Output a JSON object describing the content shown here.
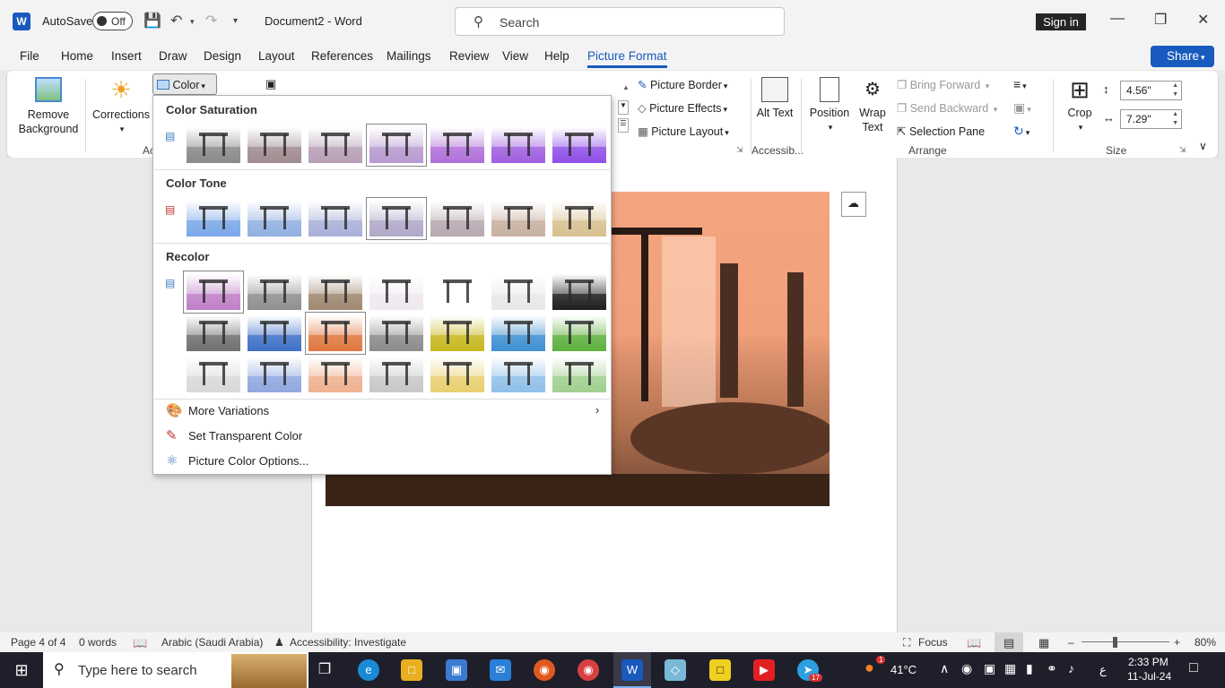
{
  "titlebar": {
    "autosave": "AutoSave",
    "toggle": "Off",
    "doc_title": "Document2  -  Word",
    "search_placeholder": "Search",
    "signin": "Sign in"
  },
  "tabs": [
    "File",
    "Home",
    "Insert",
    "Draw",
    "Design",
    "Layout",
    "References",
    "Mailings",
    "Review",
    "View",
    "Help",
    "Picture Format"
  ],
  "share": "Share",
  "ribbon": {
    "remove_bg": "Remove Background",
    "corrections": "Corrections",
    "color": "Color",
    "adjust_group": "Ac",
    "picture_border": "Picture Border",
    "picture_effects": "Picture Effects",
    "picture_layout": "Picture Layout",
    "alt_text": "Alt Text",
    "accessibility_group": "Accessib...",
    "position": "Position",
    "wrap_text": "Wrap Text",
    "bring_forward": "Bring Forward",
    "send_backward": "Send Backward",
    "selection_pane": "Selection Pane",
    "arrange_group": "Arrange",
    "crop": "Crop",
    "height": "4.56\"",
    "width": "7.29\"",
    "size_group": "Size"
  },
  "color_menu": {
    "saturation_title": "Color Saturation",
    "tone_title": "Color Tone",
    "recolor_title": "Recolor",
    "more_variations": "More Variations",
    "set_transparent": "Set Transparent Color",
    "picture_color_options": "Picture Color Options..."
  },
  "colors": {
    "accent": "#185abd",
    "saturation": [
      "#8a8a8a",
      "#a08c90",
      "#b8a0b8",
      "#b89ad0",
      "#b070d8",
      "#a060e0",
      "#9050e8"
    ],
    "tone": [
      "#7aa8e8",
      "#90b0e0",
      "#a8b0d8",
      "#b0a8c8",
      "#b8a8b0",
      "#c8b0a0",
      "#d8c090"
    ],
    "recolor_row1": [
      "#c080c8",
      "#909090",
      "#a08870",
      "#f0e8f0",
      "#ffffff",
      "#e8e8e8",
      "#202020"
    ],
    "recolor_row2": [
      "#707070",
      "#4070c8",
      "#e07840",
      "#8c8c8c",
      "#c8b820",
      "#4090d0",
      "#60b040"
    ],
    "recolor_row3": [
      "#d8d8d8",
      "#90a8e0",
      "#f0b090",
      "#c8c8c8",
      "#e8d070",
      "#90c0e8",
      "#a0d090"
    ]
  },
  "status": {
    "page": "Page 4 of 4",
    "words": "0 words",
    "language": "Arabic (Saudi Arabia)",
    "accessibility": "Accessibility: Investigate",
    "focus": "Focus",
    "zoom": "80%"
  },
  "taskbar": {
    "search_placeholder": "Type here to search",
    "temperature": "41°C",
    "lang": "ع",
    "time": "2:33 PM",
    "date": "11-Jul-24",
    "weather_badge": "1",
    "telegram_badge": "17"
  }
}
